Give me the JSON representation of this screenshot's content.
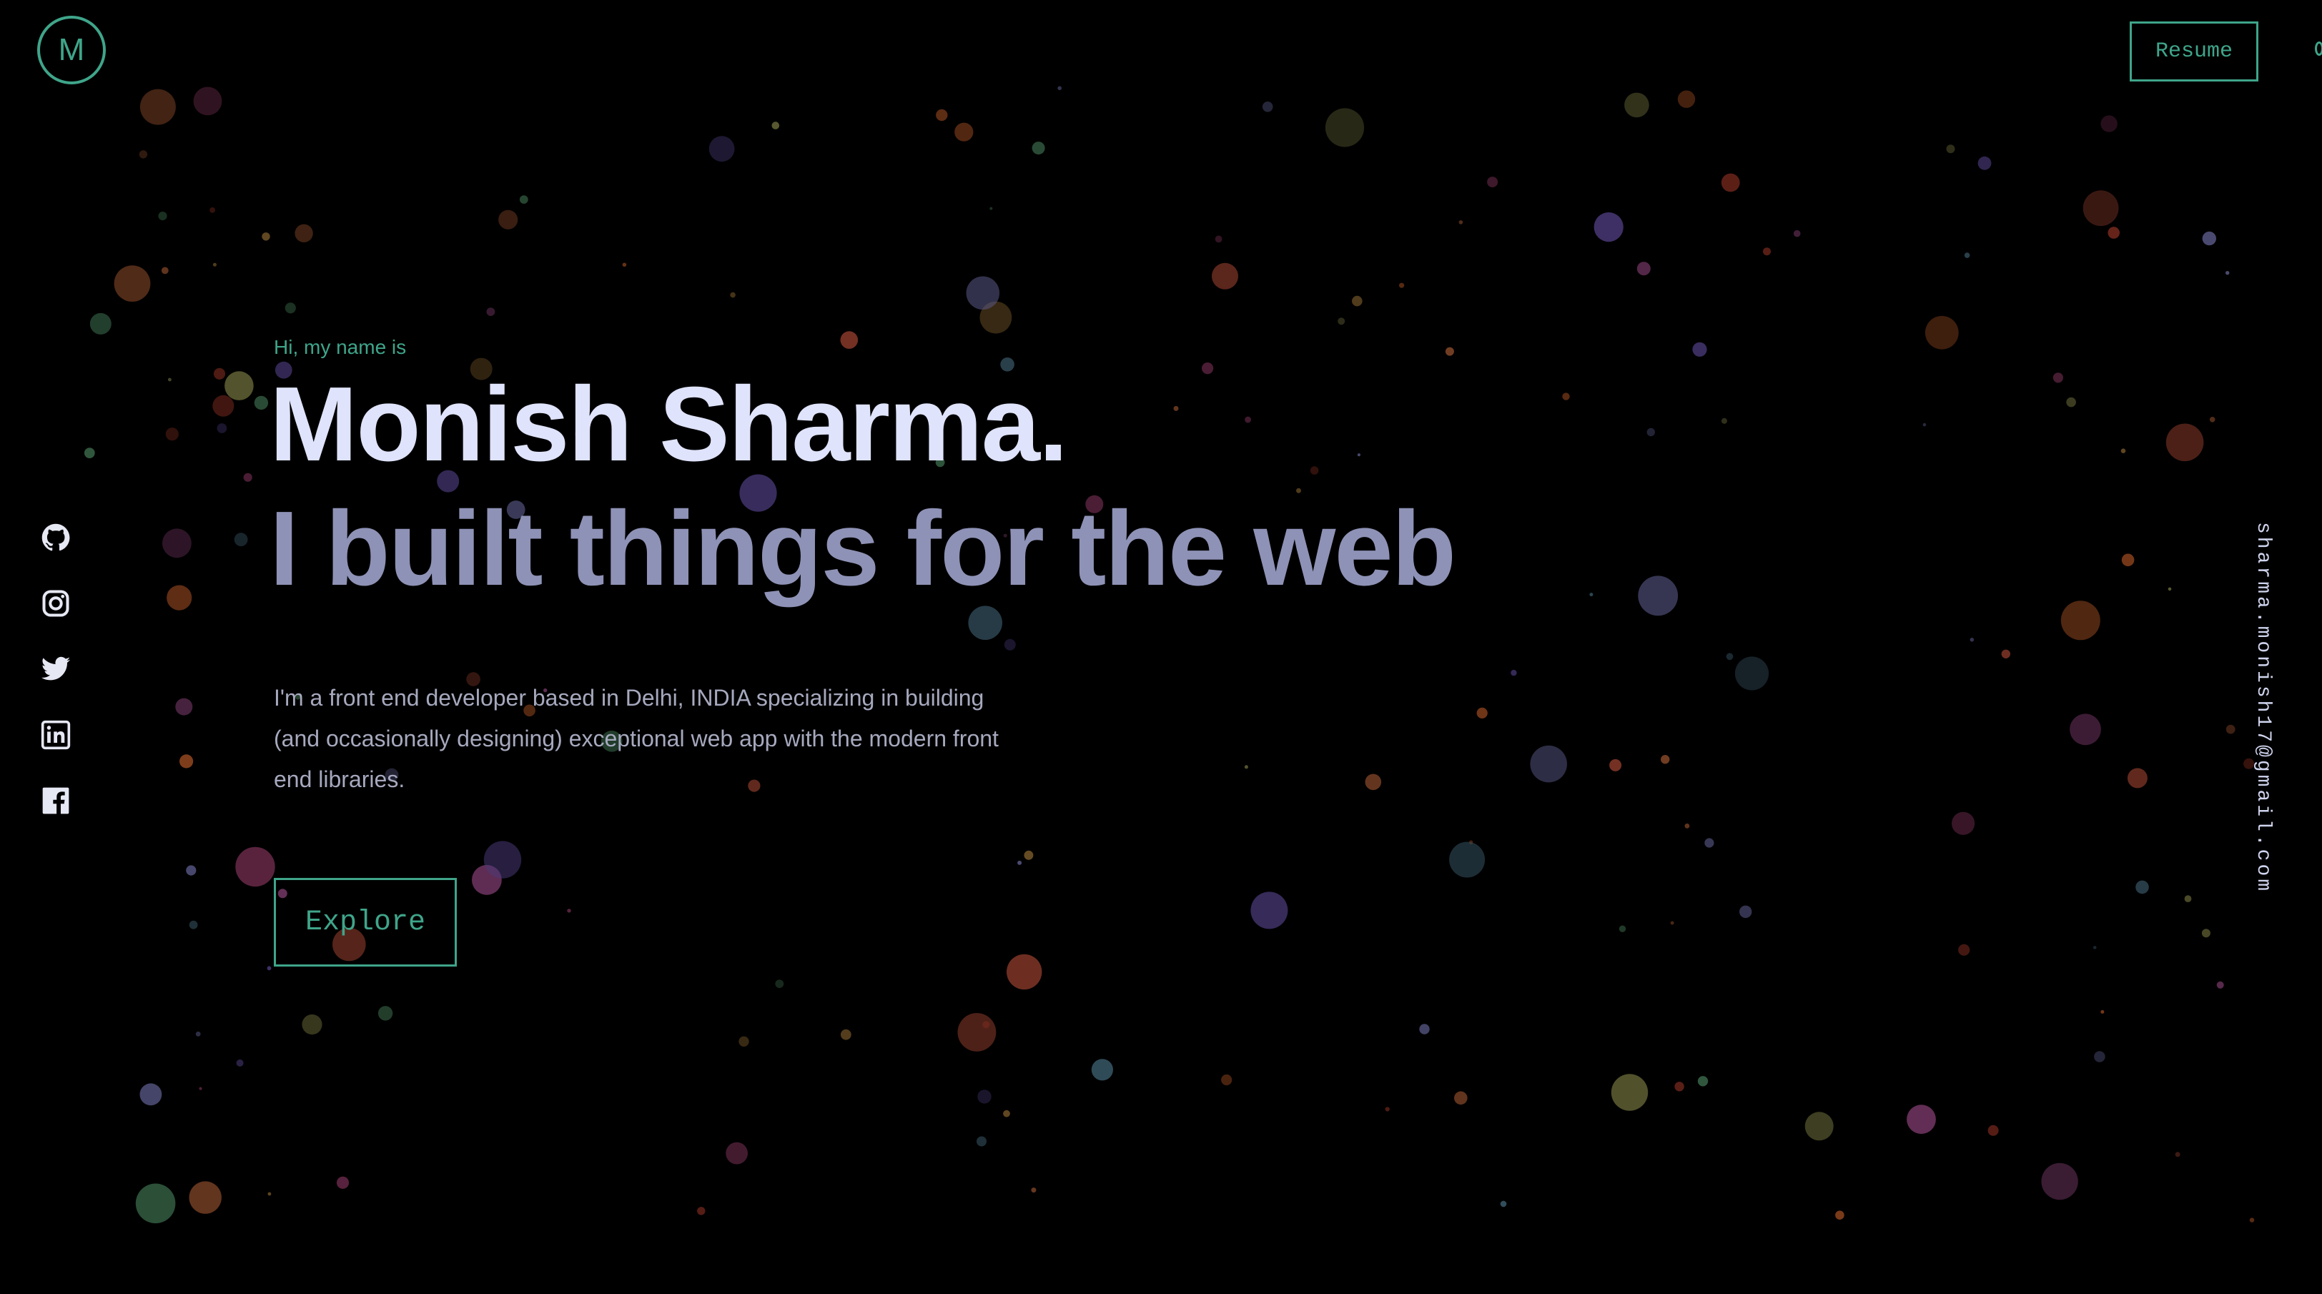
{
  "header": {
    "logo_letter": "M",
    "resume_label": "Resume",
    "accent_color": "#3fa58a"
  },
  "social": {
    "icons": [
      "github-icon",
      "instagram-icon",
      "twitter-icon",
      "linkedin-icon",
      "facebook-icon"
    ]
  },
  "email": {
    "address": "sharma.monish17@gmail.com"
  },
  "hero": {
    "greeting": "Hi, my name is",
    "name": "Monish Sharma.",
    "tagline": "I built things for the web",
    "about": "I'm a front end developer based in Delhi, INDIA specializing in building (and occasionally designing) exceptional web app with the modern front end libraries.",
    "explore_label": "Explore"
  },
  "colors": {
    "background": "#000000",
    "name_text": "#dfe3fb",
    "tagline_text": "#8e92b6",
    "body_text": "#a6a9be"
  }
}
